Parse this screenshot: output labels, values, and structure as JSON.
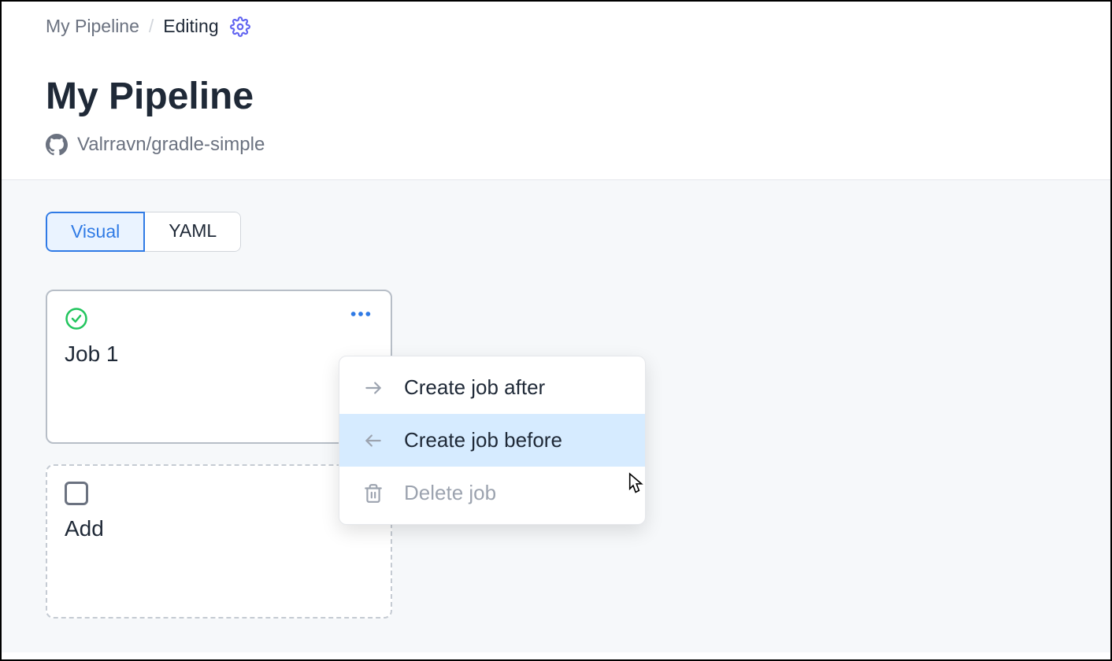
{
  "breadcrumb": {
    "root": "My Pipeline",
    "current": "Editing"
  },
  "page": {
    "title": "My Pipeline",
    "repo": "Valrravn/gradle-simple"
  },
  "tabs": {
    "visual": "Visual",
    "yaml": "YAML"
  },
  "jobs": [
    {
      "title": "Job 1"
    }
  ],
  "add_card": {
    "label": "Add"
  },
  "context_menu": {
    "create_after": "Create job after",
    "create_before": "Create job before",
    "delete": "Delete job"
  },
  "icons": {
    "gear": "gear-icon",
    "github": "github-icon",
    "check": "check-circle-icon",
    "more": "more-horizontal-icon",
    "arrow_right": "arrow-right-icon",
    "arrow_left": "arrow-left-icon",
    "trash": "trash-icon"
  }
}
